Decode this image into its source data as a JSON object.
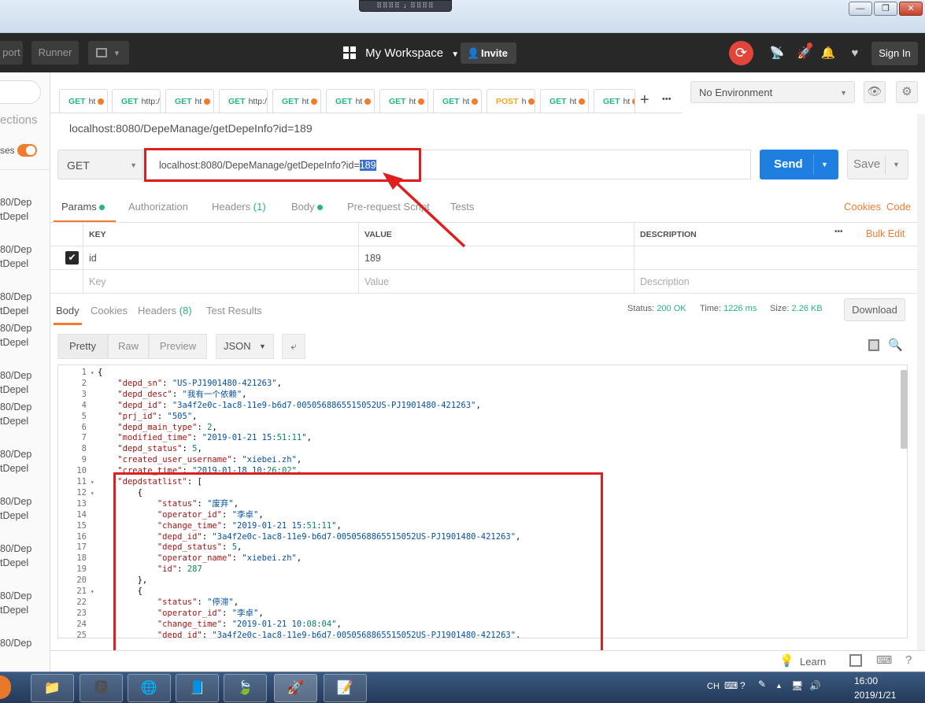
{
  "window": {
    "snap": "⠿⠿⠿⠿ ↓ ⠿⠿⠿⠿",
    "min": "—",
    "restore": "❐",
    "close": "✕"
  },
  "appbar": {
    "import_label": "port",
    "runner_label": "Runner",
    "new_label": "▾",
    "workspace_label": "My Workspace",
    "invite_label": "Invite",
    "signin_label": "Sign In"
  },
  "sidebar": {
    "search_placeholder": "",
    "collections_label": "ections",
    "toggle_label": "ses",
    "history": [
      {
        "a": "80/Dep",
        "b": "tDepel"
      },
      {
        "a": "80/Dep",
        "b": "tDepel"
      },
      {
        "a": "80/Dep",
        "b": "tDepel"
      },
      {
        "a": "80/Dep",
        "b": "tDepel"
      },
      {
        "a": "80/Dep",
        "b": "tDepel"
      },
      {
        "a": "80/Dep",
        "b": "tDepel"
      },
      {
        "a": "80/Dep",
        "b": "tDepel"
      },
      {
        "a": "80/Dep",
        "b": "tDepel"
      },
      {
        "a": "80/Dep",
        "b": "tDepel"
      },
      {
        "a": "80/Dep",
        "b": "tDepel"
      },
      {
        "a": "80/Dep",
        "b": ""
      }
    ]
  },
  "tabs": [
    {
      "method": "GET",
      "label": "ht",
      "dot": true
    },
    {
      "method": "GET",
      "label": "http:/",
      "dot": false
    },
    {
      "method": "GET",
      "label": "ht",
      "dot": true
    },
    {
      "method": "GET",
      "label": "http:/",
      "dot": false
    },
    {
      "method": "GET",
      "label": "ht",
      "dot": true
    },
    {
      "method": "GET",
      "label": "ht",
      "dot": true
    },
    {
      "method": "GET",
      "label": "ht",
      "dot": true
    },
    {
      "method": "GET",
      "label": "ht",
      "dot": true
    },
    {
      "method": "POST",
      "label": "h",
      "dot": true
    },
    {
      "method": "GET",
      "label": "ht",
      "dot": true
    },
    {
      "method": "GET",
      "label": "ht",
      "dot": true
    }
  ],
  "tabs_add": "+",
  "tabs_more": "•••",
  "environment": {
    "selected": "No Environment"
  },
  "request": {
    "title": "localhost:8080/DepeManage/getDepeInfo?id=189",
    "method": "GET",
    "url_prefix": "localhost:8080/DepeManage/getDepeInfo?id=",
    "url_selected": "189",
    "send_label": "Send",
    "save_label": "Save"
  },
  "req_tabs": {
    "params": "Params",
    "authorization": "Authorization",
    "headers": "Headers",
    "headers_count": "(1)",
    "body": "Body",
    "prerequest": "Pre-request Script",
    "tests": "Tests",
    "cookies": "Cookies",
    "code": "Code"
  },
  "params_table": {
    "headers": [
      "KEY",
      "VALUE",
      "DESCRIPTION"
    ],
    "more": "•••",
    "bulk_edit": "Bulk Edit",
    "row": {
      "key": "id",
      "value": "189",
      "description": ""
    },
    "placeholder": {
      "key": "Key",
      "value": "Value",
      "description": "Description"
    }
  },
  "response_tabs": {
    "body": "Body",
    "cookies": "Cookies",
    "headers": "Headers",
    "headers_count": "(8)",
    "test_results": "Test Results"
  },
  "response_status": {
    "status_label": "Status:",
    "status_value": "200 OK",
    "time_label": "Time:",
    "time_value": "1226 ms",
    "size_label": "Size:",
    "size_value": "2.26 KB",
    "download_label": "Download"
  },
  "view_buttons": {
    "pretty": "Pretty",
    "raw": "Raw",
    "preview": "Preview",
    "format": "JSON"
  },
  "code_lines": [
    {
      "n": "1",
      "fold": true,
      "text": "{"
    },
    {
      "n": "2",
      "fold": false,
      "text": "    \"depd_sn\": \"US-PJ1901480-421263\","
    },
    {
      "n": "3",
      "fold": false,
      "text": "    \"depd_desc\": \"我有一个依赖\","
    },
    {
      "n": "4",
      "fold": false,
      "text": "    \"depd_id\": \"3a4f2e0c-1ac8-11e9-b6d7-0050568865515052US-PJ1901480-421263\","
    },
    {
      "n": "5",
      "fold": false,
      "text": "    \"prj_id\": \"505\","
    },
    {
      "n": "6",
      "fold": false,
      "text": "    \"depd_main_type\": 2,"
    },
    {
      "n": "7",
      "fold": false,
      "text": "    \"modified_time\": \"2019-01-21 15:51:11\","
    },
    {
      "n": "8",
      "fold": false,
      "text": "    \"depd_status\": 5,"
    },
    {
      "n": "9",
      "fold": false,
      "text": "    \"created_user_username\": \"xiebei.zh\","
    },
    {
      "n": "10",
      "fold": false,
      "text": "    \"create_time\": \"2019-01-18 10:26:02\","
    },
    {
      "n": "11",
      "fold": true,
      "text": "    \"depdstatlist\": ["
    },
    {
      "n": "12",
      "fold": true,
      "text": "        {"
    },
    {
      "n": "13",
      "fold": false,
      "text": "            \"status\": \"废弃\","
    },
    {
      "n": "14",
      "fold": false,
      "text": "            \"operator_id\": \"李卓\","
    },
    {
      "n": "15",
      "fold": false,
      "text": "            \"change_time\": \"2019-01-21 15:51:11\","
    },
    {
      "n": "16",
      "fold": false,
      "text": "            \"depd_id\": \"3a4f2e0c-1ac8-11e9-b6d7-0050568865515052US-PJ1901480-421263\","
    },
    {
      "n": "17",
      "fold": false,
      "text": "            \"depd_status\": 5,"
    },
    {
      "n": "18",
      "fold": false,
      "text": "            \"operator_name\": \"xiebei.zh\","
    },
    {
      "n": "19",
      "fold": false,
      "text": "            \"id\": 287"
    },
    {
      "n": "20",
      "fold": false,
      "text": "        },"
    },
    {
      "n": "21",
      "fold": true,
      "text": "        {"
    },
    {
      "n": "22",
      "fold": false,
      "text": "            \"status\": \"停滞\","
    },
    {
      "n": "23",
      "fold": false,
      "text": "            \"operator_id\": \"李卓\","
    },
    {
      "n": "24",
      "fold": false,
      "text": "            \"change_time\": \"2019-01-21 10:08:04\","
    },
    {
      "n": "25",
      "fold": false,
      "text": "            \"depd_id\": \"3a4f2e0c-1ac8-11e9-b6d7-0050568865515052US-PJ1901480-421263\","
    }
  ],
  "footer": {
    "learn_label": "Learn"
  },
  "taskbar": {
    "lang": "CH",
    "time": "16:00",
    "date": "2019/1/21"
  },
  "colors": {
    "accent_orange": "#f07d2f",
    "send_blue": "#1f7fe0",
    "success_green": "#26b47f",
    "annotation_red": "#dd1f1f",
    "selection_blue": "#3a6fd6"
  },
  "icons": [
    "grid-icon",
    "person-plus-icon",
    "sync-icon",
    "satellite-icon",
    "rocket-icon",
    "bell-icon",
    "heart-icon",
    "eye-icon",
    "gear-icon",
    "copy-icon",
    "search-icon",
    "wrap-icon",
    "bulb-icon",
    "columns-icon",
    "keyboard-icon",
    "help-icon"
  ]
}
